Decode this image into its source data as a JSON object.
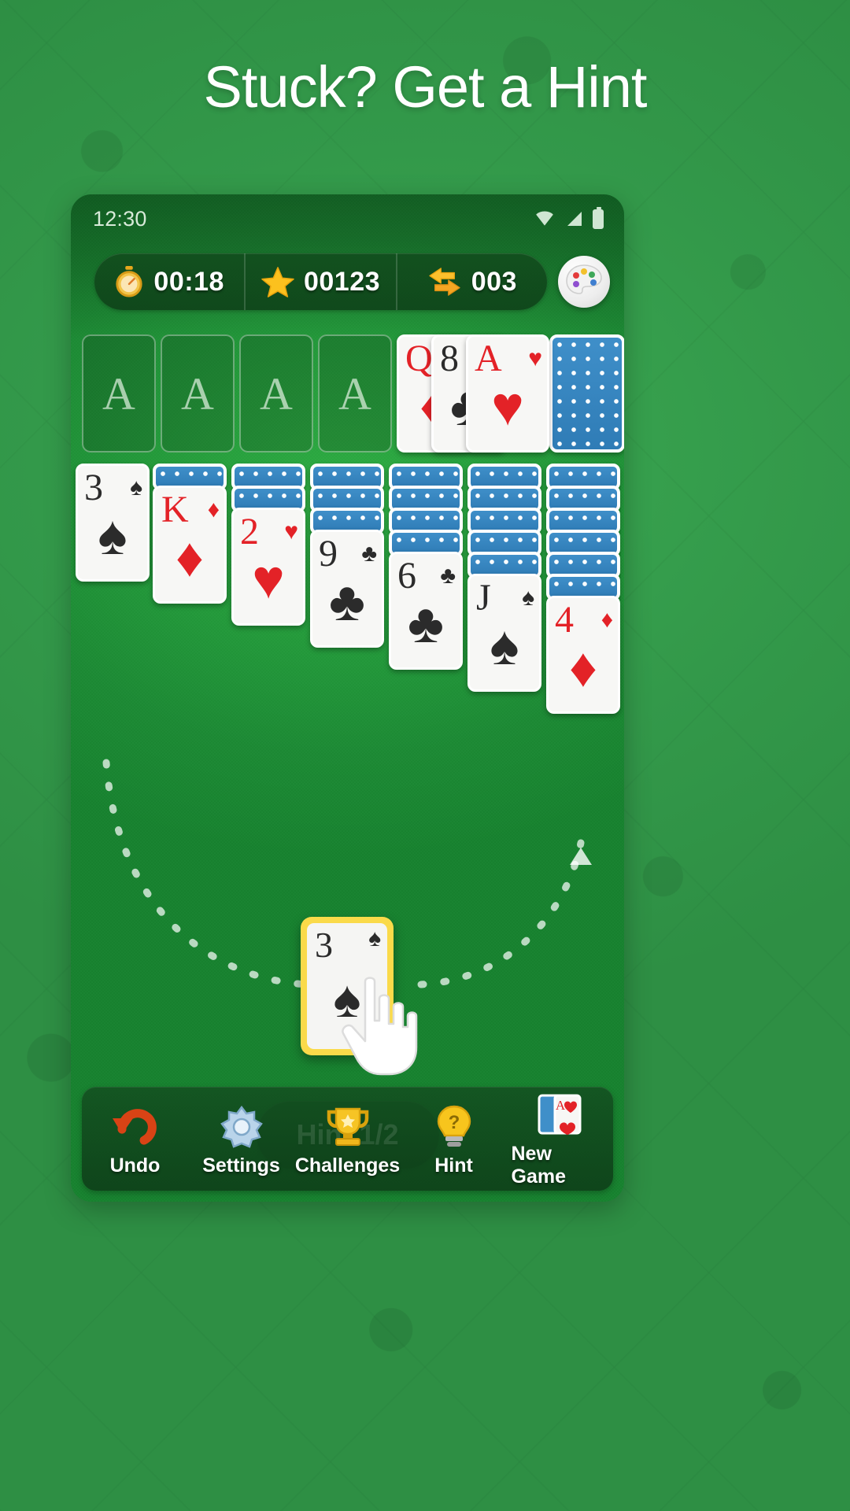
{
  "headline": "Stuck? Get a Hint",
  "status_bar": {
    "time": "12:30",
    "icons": [
      "wifi-icon",
      "signal-icon",
      "battery-icon"
    ]
  },
  "hud": {
    "timer": {
      "icon": "stopwatch-icon",
      "value": "00:18"
    },
    "score": {
      "icon": "star-icon",
      "value": "00123"
    },
    "moves": {
      "icon": "swap-arrows-icon",
      "value": "003"
    },
    "theme_button": {
      "icon": "palette-icon",
      "label": ""
    }
  },
  "board": {
    "foundations": [
      {
        "placeholder": "A"
      },
      {
        "placeholder": "A"
      },
      {
        "placeholder": "A"
      },
      {
        "placeholder": "A"
      }
    ],
    "waste": [
      {
        "rank": "Q",
        "suit": "♦",
        "color": "red"
      },
      {
        "rank": "8",
        "suit": "♣",
        "color": "black"
      },
      {
        "rank": "A",
        "suit": "♥",
        "color": "red"
      }
    ],
    "stock": {
      "face_down": true,
      "label": "stock-pile"
    },
    "tableau": [
      {
        "face_down": 0,
        "top": {
          "rank": "3",
          "suit": "♠",
          "color": "black"
        }
      },
      {
        "face_down": 1,
        "top": {
          "rank": "K",
          "suit": "♦",
          "color": "red"
        }
      },
      {
        "face_down": 2,
        "top": {
          "rank": "2",
          "suit": "♥",
          "color": "red"
        }
      },
      {
        "face_down": 3,
        "top": {
          "rank": "9",
          "suit": "♣",
          "color": "black"
        }
      },
      {
        "face_down": 4,
        "top": {
          "rank": "6",
          "suit": "♣",
          "color": "black"
        }
      },
      {
        "face_down": 5,
        "top": {
          "rank": "J",
          "suit": "♠",
          "color": "black"
        }
      },
      {
        "face_down": 6,
        "top": {
          "rank": "4",
          "suit": "♦",
          "color": "red"
        }
      }
    ]
  },
  "hint": {
    "card": {
      "rank": "3",
      "suit": "♠",
      "color": "black"
    },
    "cursor_icon": "hand-pointer-icon",
    "arrow_icon": "dashed-arc-arrow-icon",
    "button_label": "Hint 1/2"
  },
  "toolbar": [
    {
      "icon": "undo-arrow-icon",
      "label": "Undo"
    },
    {
      "icon": "gear-icon",
      "label": "Settings"
    },
    {
      "icon": "trophy-icon",
      "label": "Challenges"
    },
    {
      "icon": "lightbulb-icon",
      "label": "Hint"
    },
    {
      "icon": "cards-icon",
      "label": "New Game"
    }
  ],
  "colors": {
    "background_green": "#36a04a",
    "felt_green": "#22983a",
    "card_back_blue": "#3f8fc9",
    "red_suit": "#e32227",
    "black_suit": "#2b2b2b",
    "hint_yellow": "#fada4a",
    "hud_dark": "#124d1f"
  }
}
